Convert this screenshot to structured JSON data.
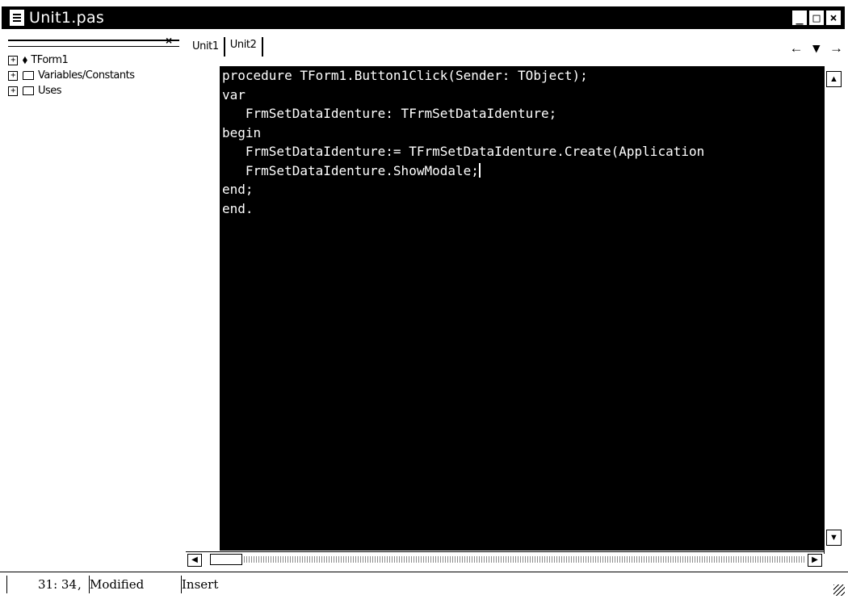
{
  "window": {
    "title": "Unit1.pas",
    "buttons": {
      "minimize": "_",
      "maximize": "□",
      "close": "×"
    }
  },
  "tree": {
    "close_glyph": "×",
    "items": [
      {
        "label": "TForm1",
        "icon": "class-icon"
      },
      {
        "label": "Variables/Constants",
        "icon": "folder-icon"
      },
      {
        "label": "Uses",
        "icon": "folder-icon"
      }
    ]
  },
  "tabs": [
    {
      "label": "Unit1",
      "active": true
    },
    {
      "label": "Unit2",
      "active": false
    }
  ],
  "nav": {
    "back": "←",
    "dropdown": "▾",
    "forward": "→"
  },
  "editor": {
    "lines": [
      "procedure TForm1.Button1Click(Sender: TObject);",
      "var",
      "   FrmSetDataIdenture: TFrmSetDataIdenture;",
      "begin",
      "   FrmSetDataIdenture:= TFrmSetDataIdenture.Create(Application",
      "   FrmSetDataIdenture.ShowModale;",
      "end;",
      "",
      "end."
    ]
  },
  "status": {
    "position": "31: 34",
    "modified": "Modified",
    "mode": "Insert"
  },
  "colors": {
    "editor_bg": "#000000",
    "editor_fg": "#ffffff"
  }
}
